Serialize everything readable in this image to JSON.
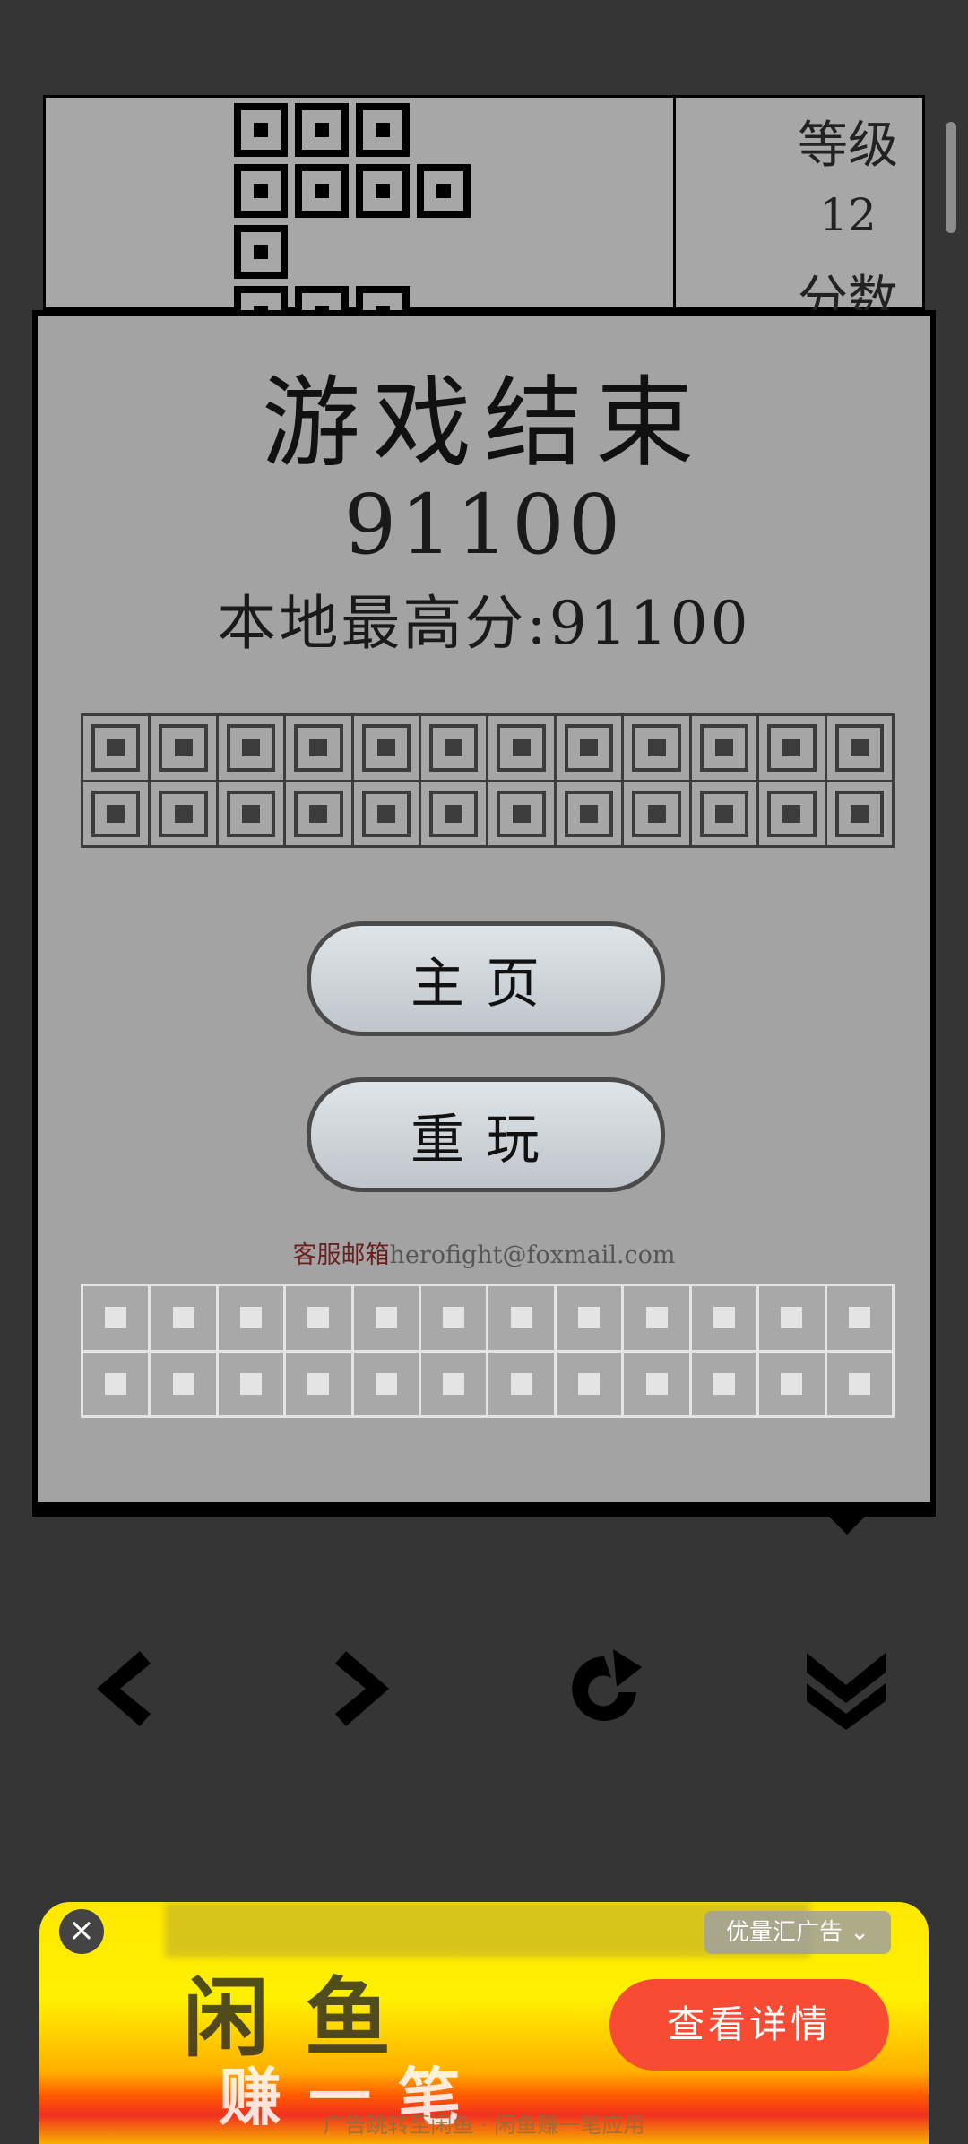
{
  "board": {
    "level_label": "等级",
    "level_value": "12",
    "score_label": "分数"
  },
  "dialog": {
    "title": "游戏结束",
    "score": "91100",
    "best_label": "本地最高分:91100",
    "home_button": "主页",
    "replay_button": "重玩",
    "contact_label": "客服邮箱",
    "contact_email": "herofight@foxmail.com"
  },
  "controls": {
    "left": "left-arrow-icon",
    "right": "right-arrow-icon",
    "rotate": "rotate-icon",
    "drop": "double-chevron-down-icon"
  },
  "ad": {
    "tag": "优量汇广告",
    "cta": "查看详情",
    "headline": "闲鱼",
    "slogan": "赚一笔",
    "caption": "广告跳转至闲鱼 · 闲鱼赚一笔应用"
  },
  "colors": {
    "background": "#353535",
    "dialog": "#a3a3a3",
    "button": "#d4d9dd",
    "cta": "#f84b34"
  }
}
